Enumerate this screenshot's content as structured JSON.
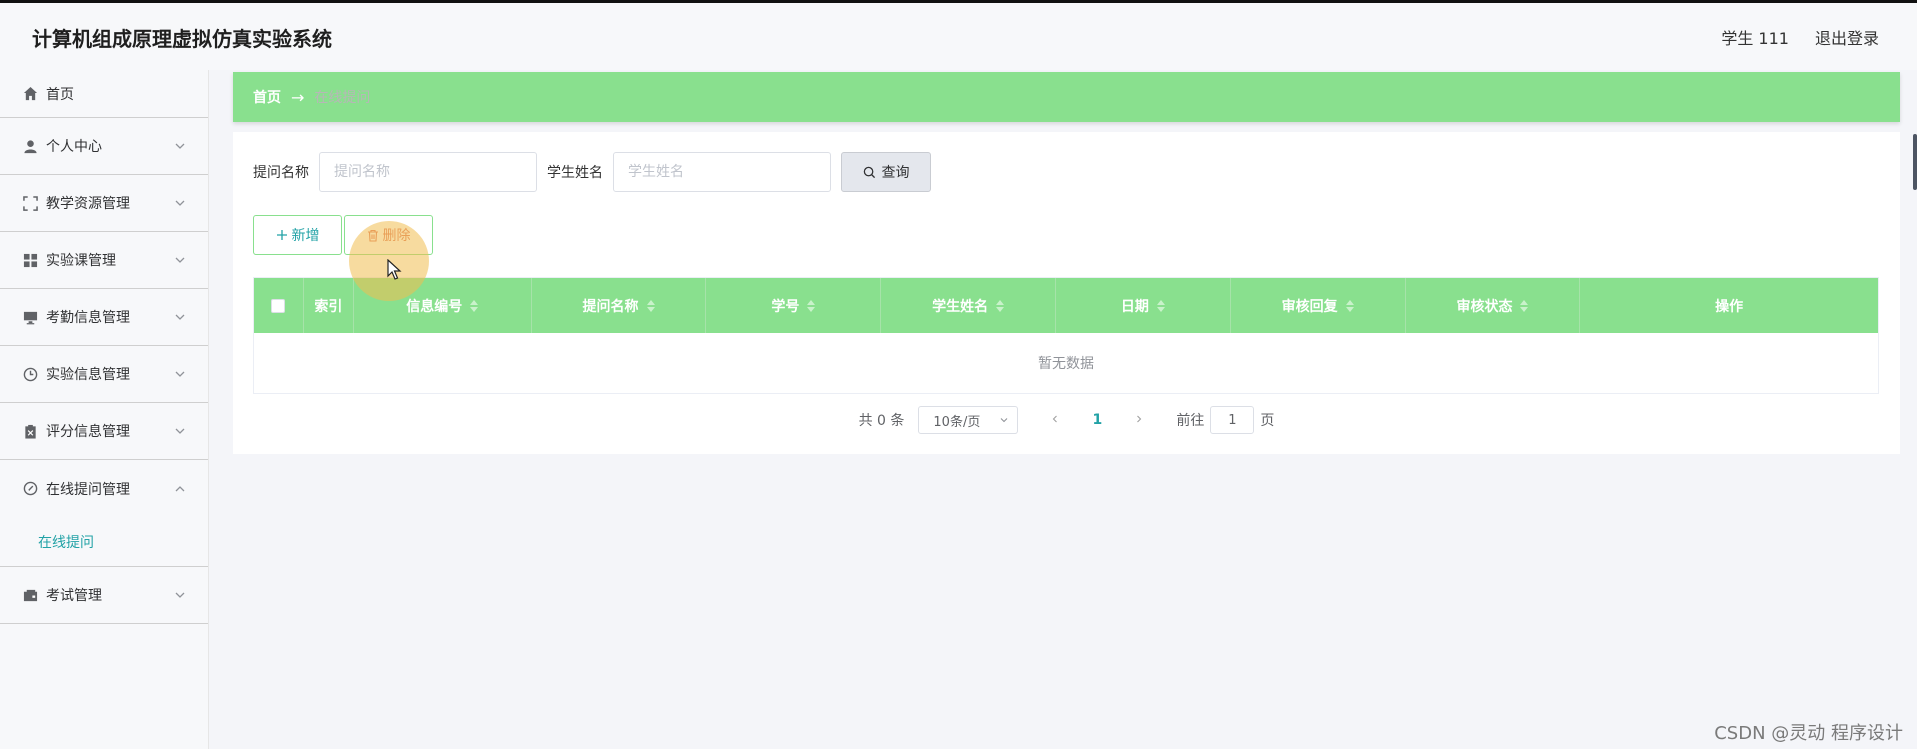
{
  "header": {
    "app_title": "计算机组成原理虚拟仿真实验系统",
    "user_label": "学生 111",
    "logout_label": "退出登录"
  },
  "sidebar": {
    "items": [
      {
        "label": "首页",
        "icon": "home-icon"
      },
      {
        "label": "个人中心",
        "icon": "user-icon"
      },
      {
        "label": "教学资源管理",
        "icon": "fullscreen-icon"
      },
      {
        "label": "实验课管理",
        "icon": "grid-icon"
      },
      {
        "label": "考勤信息管理",
        "icon": "monitor-icon"
      },
      {
        "label": "实验信息管理",
        "icon": "clock-icon"
      },
      {
        "label": "评分信息管理",
        "icon": "clipboard-icon"
      },
      {
        "label": "在线提问管理",
        "icon": "compass-icon"
      },
      {
        "label": "考试管理",
        "icon": "wallet-icon"
      }
    ],
    "sub_item": "在线提问"
  },
  "breadcrumb": {
    "home": "首页",
    "arrow": "→",
    "current": "在线提问"
  },
  "search": {
    "label1": "提问名称",
    "placeholder1": "提问名称",
    "label2": "学生姓名",
    "placeholder2": "学生姓名",
    "query_label": "查询"
  },
  "actions": {
    "add_label": "新增",
    "delete_label": "删除"
  },
  "table": {
    "columns": [
      "",
      "索引",
      "信息编号",
      "提问名称",
      "学号",
      "学生姓名",
      "日期",
      "审核回复",
      "审核状态",
      "操作"
    ],
    "empty_text": "暂无数据"
  },
  "pagination": {
    "total": "共 0 条",
    "page_size": "10条/页",
    "current_page": "1",
    "goto_label": "前往",
    "goto_value": "1",
    "page_suffix": "页"
  },
  "watermark": "CSDN @灵动 程序设计",
  "colors": {
    "accent_green": "#89e08e",
    "teal_text": "#22a2a6",
    "delete_orange": "#e07a5f"
  }
}
